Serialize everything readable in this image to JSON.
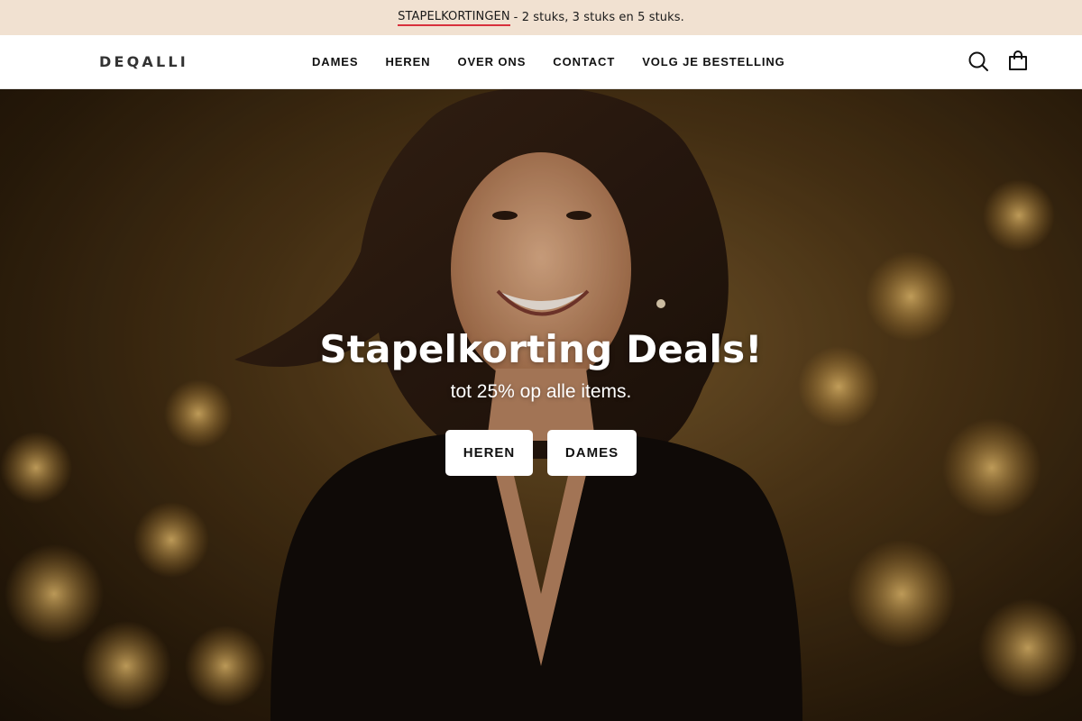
{
  "announcement": {
    "link_label": "STAPELKORTINGEN",
    "text": "- 2 stuks, 3 stuks en 5 stuks."
  },
  "header": {
    "logo": "DEQALLI",
    "nav": [
      "DAMES",
      "HEREN",
      "OVER ONS",
      "CONTACT",
      "VOLG JE BESTELLING"
    ],
    "icons": [
      "search-icon",
      "shopping-bag-icon"
    ]
  },
  "hero": {
    "title": "Stapelkorting Deals!",
    "subtitle": "tot 25% op alle items.",
    "buttons": [
      "HEREN",
      "DAMES"
    ]
  },
  "colors": {
    "announcement_bg": "#f1e1d1",
    "link_underline": "#d8303c",
    "hero_tone": "#6b4a20",
    "button_bg": "#ffffff"
  }
}
